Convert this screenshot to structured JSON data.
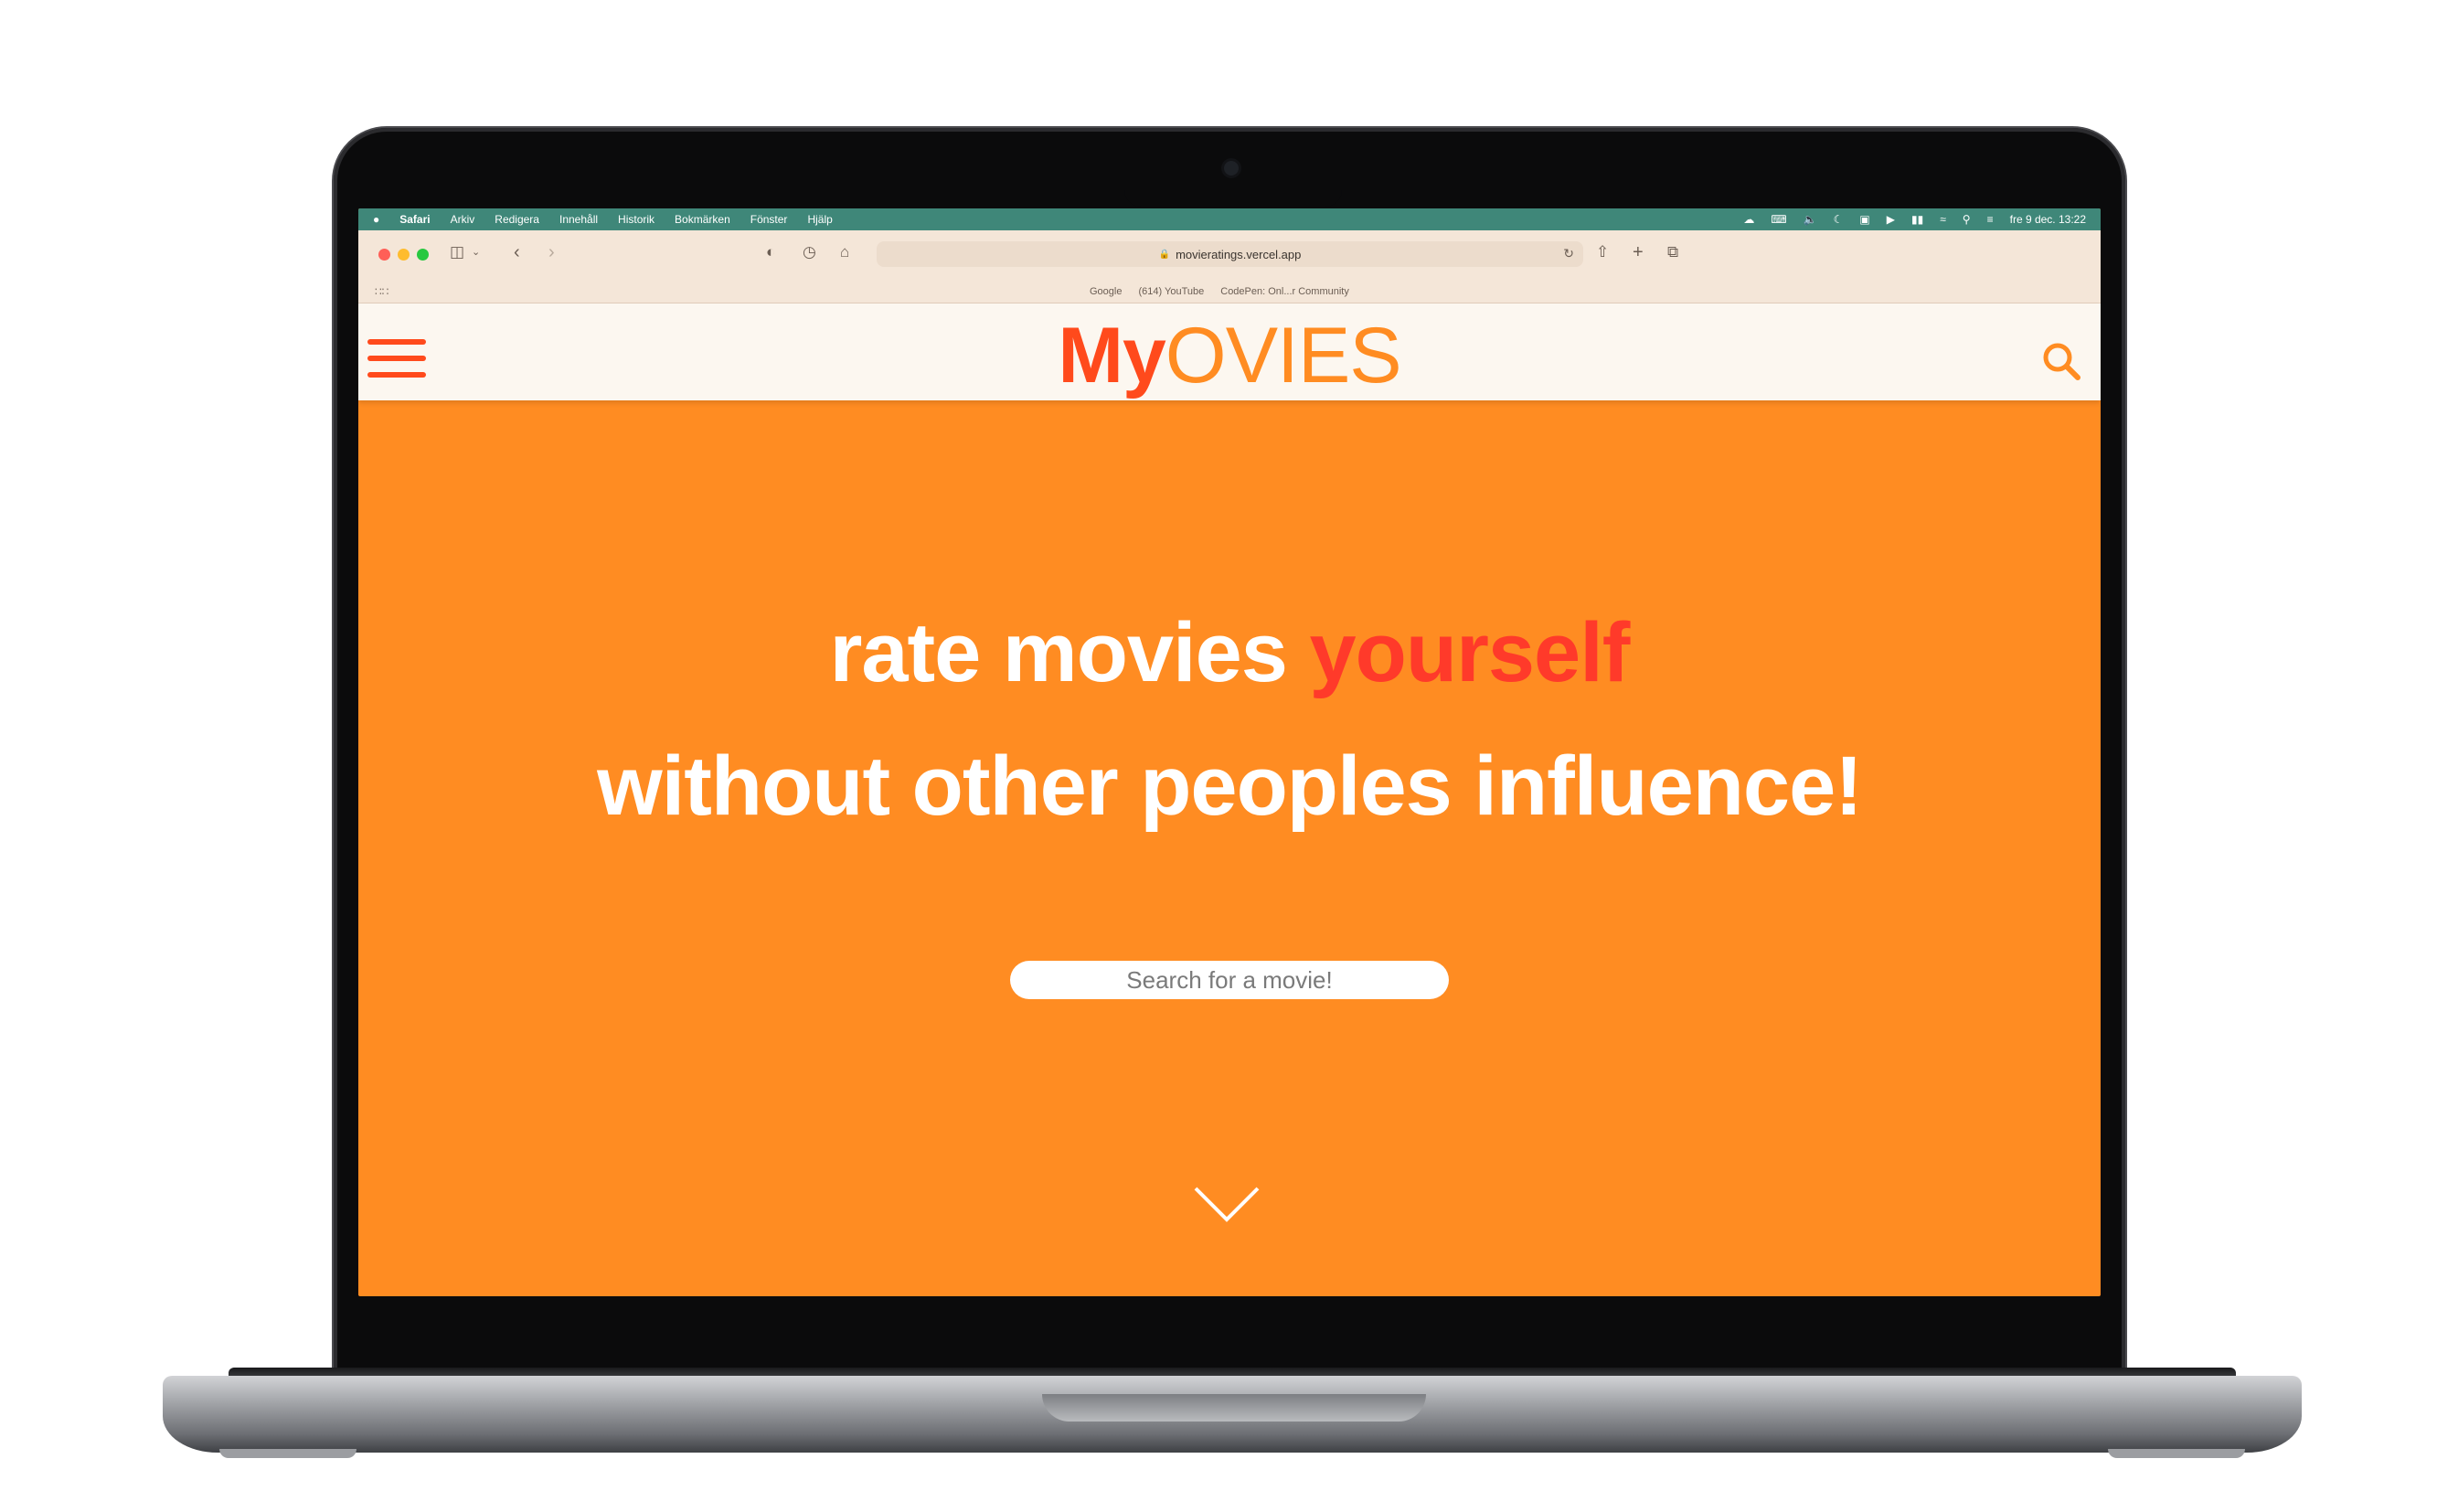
{
  "menubar": {
    "app": "Safari",
    "items": [
      "Arkiv",
      "Redigera",
      "Innehåll",
      "Historik",
      "Bokmärken",
      "Fönster",
      "Hjälp"
    ],
    "clock": "fre 9 dec.  13:22"
  },
  "browser": {
    "url": "movieratings.vercel.app",
    "favorites": [
      "Google",
      "(614) YouTube",
      "CodePen: Onl...r Community"
    ]
  },
  "site": {
    "logo_my": "My",
    "logo_ovies": "OVIES",
    "hero_line1_part1": "rate movies ",
    "hero_line1_accent": "yourself",
    "hero_line2": "without other peoples influence!",
    "search_placeholder": "Search for a movie!"
  },
  "colors": {
    "brand_orange": "#ff8c22",
    "brand_red": "#ff4a1c",
    "accent_red": "#ff3a2a",
    "header_bg": "#fcf7f0",
    "menubar_bg": "#3f8779"
  }
}
